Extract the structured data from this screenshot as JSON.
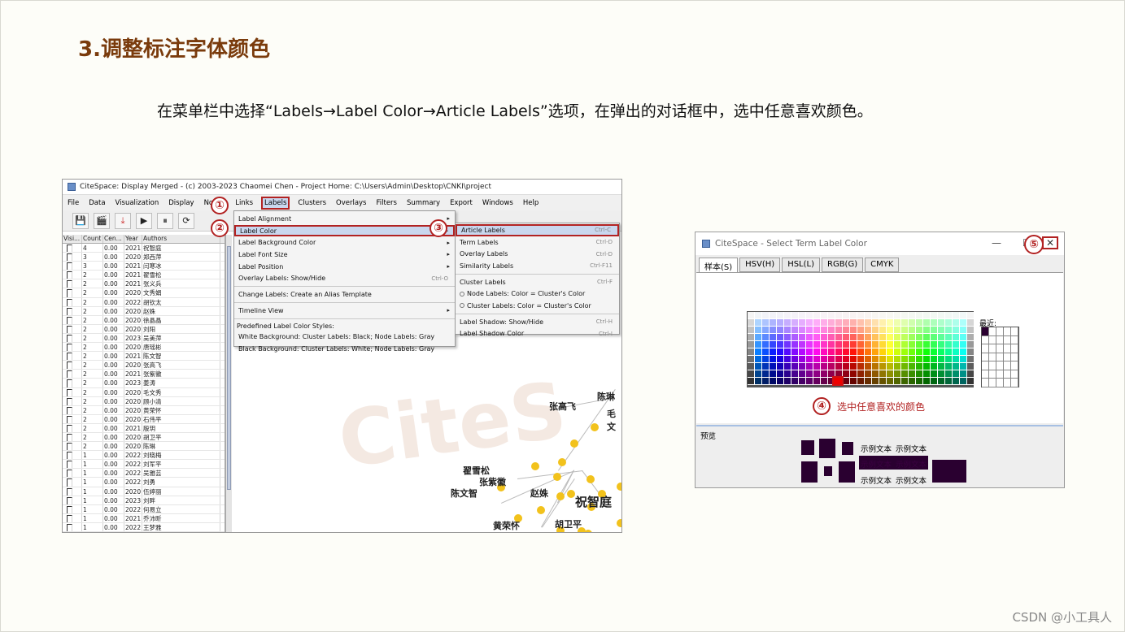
{
  "slide": {
    "title": "3.调整标注字体颜色",
    "instruction": "在菜单栏中选择“Labels→Label Color→Article Labels”选项，在弹出的对话框中，选中任意喜欢颜色。",
    "watermark": "CSDN @小工具人"
  },
  "left_window": {
    "title": "CiteSpace: Display Merged - (c) 2003-2023 Chaomei Chen - Project Home: C:\\Users\\Admin\\Desktop\\CNKI\\project",
    "menus": [
      "File",
      "Data",
      "Visualization",
      "Display",
      "Nodes",
      "Links",
      "Labels",
      "Clusters",
      "Overlays",
      "Filters",
      "Summary",
      "Export",
      "Windows",
      "Help"
    ],
    "active_menu": "Labels",
    "table_headers": [
      "Visi...",
      "Count",
      "Cen...",
      "Year",
      "Authors"
    ],
    "table_rows": [
      [
        "4",
        "0.00",
        "2021",
        "祝智庭"
      ],
      [
        "3",
        "0.00",
        "2020",
        "郑西萍"
      ],
      [
        "3",
        "0.00",
        "2021",
        "闫寒冰"
      ],
      [
        "2",
        "0.00",
        "2021",
        "翟雪松"
      ],
      [
        "2",
        "0.00",
        "2021",
        "张义兵"
      ],
      [
        "2",
        "0.00",
        "2020",
        "文秀娟"
      ],
      [
        "2",
        "0.00",
        "2022",
        "胡钦太"
      ],
      [
        "2",
        "0.00",
        "2020",
        "赵姝"
      ],
      [
        "2",
        "0.00",
        "2020",
        "徐晶晶"
      ],
      [
        "2",
        "0.00",
        "2020",
        "刘阳"
      ],
      [
        "2",
        "0.00",
        "2023",
        "吴美萍"
      ],
      [
        "2",
        "0.00",
        "2020",
        "唐瑶彬"
      ],
      [
        "2",
        "0.00",
        "2021",
        "陈文智"
      ],
      [
        "2",
        "0.00",
        "2020",
        "张高飞"
      ],
      [
        "2",
        "0.00",
        "2021",
        "张紫徽"
      ],
      [
        "2",
        "0.00",
        "2023",
        "姜涛"
      ],
      [
        "2",
        "0.00",
        "2020",
        "毛文秀"
      ],
      [
        "2",
        "0.00",
        "2020",
        "顾小清"
      ],
      [
        "2",
        "0.00",
        "2020",
        "黄荣怀"
      ],
      [
        "2",
        "0.00",
        "2020",
        "石伟平"
      ],
      [
        "2",
        "0.00",
        "2021",
        "殷玥"
      ],
      [
        "2",
        "0.00",
        "2020",
        "胡卫平"
      ],
      [
        "2",
        "0.00",
        "2020",
        "陈琳"
      ],
      [
        "1",
        "0.00",
        "2022",
        "刘晓梅"
      ],
      [
        "1",
        "0.00",
        "2022",
        "刘军平"
      ],
      [
        "1",
        "0.00",
        "2022",
        "吴雅芸"
      ],
      [
        "1",
        "0.00",
        "2022",
        "刘勇"
      ],
      [
        "1",
        "0.00",
        "2020",
        "伍婷丽"
      ],
      [
        "1",
        "0.00",
        "2023",
        "刘畔"
      ],
      [
        "1",
        "0.00",
        "2022",
        "何易立"
      ],
      [
        "1",
        "0.00",
        "2021",
        "乔沛昕"
      ],
      [
        "1",
        "0.00",
        "2022",
        "王梦雅"
      ]
    ],
    "labels_menu": {
      "items": [
        {
          "label": "Label Alignment",
          "arrow": "▸"
        },
        {
          "label": "Label Color",
          "arrow": "▸"
        },
        {
          "label": "Label Background Color",
          "arrow": "▸"
        },
        {
          "label": "Label Font Size",
          "arrow": "▸"
        },
        {
          "label": "Label Position",
          "arrow": "▸"
        },
        {
          "label": "Overlay Labels: Show/Hide",
          "shortcut": "Ctrl-O"
        }
      ],
      "alias": "Change Labels: Create an Alias Template",
      "timeline": "Timeline View",
      "predef_header": "Predefined Label Color Styles:",
      "predef_1": "White Background: Cluster Labels: Black; Node Labels: Gray",
      "predef_2": "Black Background: Cluster Labels: White; Node Labels: Gray"
    },
    "color_submenu": {
      "items": [
        {
          "label": "Article Labels",
          "shortcut": "Ctrl-C"
        },
        {
          "label": "Term Labels",
          "shortcut": "Ctrl-D"
        },
        {
          "label": "Overlay Labels",
          "shortcut": "Ctrl-D"
        },
        {
          "label": "Similarity Labels",
          "shortcut": "Ctrl-F11"
        },
        {
          "label": "Cluster Labels",
          "shortcut": "Ctrl-F"
        },
        {
          "label": "Node Labels: Color = Cluster's Color"
        },
        {
          "label": "Cluster Labels: Color = Cluster's Color"
        },
        {
          "label": "Label Shadow: Show/Hide",
          "shortcut": "Ctrl-H"
        },
        {
          "label": "Label Shadow Color",
          "shortcut": "Ctrl-I"
        }
      ]
    },
    "canvas_labels": [
      "张高飞",
      "陈琳",
      "毛文",
      "翟雪松",
      "张紫徽",
      "陈文智",
      "赵姝",
      "祝智庭",
      "黄荣怀",
      "胡卫平"
    ],
    "canvas_watermark": "CiteS"
  },
  "callouts": [
    "①",
    "②",
    "③",
    "④",
    "⑤"
  ],
  "right_window": {
    "title": "CiteSpace - Select Term Label Color",
    "tabs": [
      "样本(S)",
      "HSV(H)",
      "HSL(L)",
      "RGB(G)",
      "CMYK"
    ],
    "recent_label": "最近:",
    "step4_text": "选中任意喜欢的颜色",
    "preview_label": "预览",
    "sample_text": "示例文本",
    "close_glyph": "✕",
    "minimize_glyph": "—",
    "maximize_glyph": "☐",
    "recent_color": "#2a0030"
  }
}
